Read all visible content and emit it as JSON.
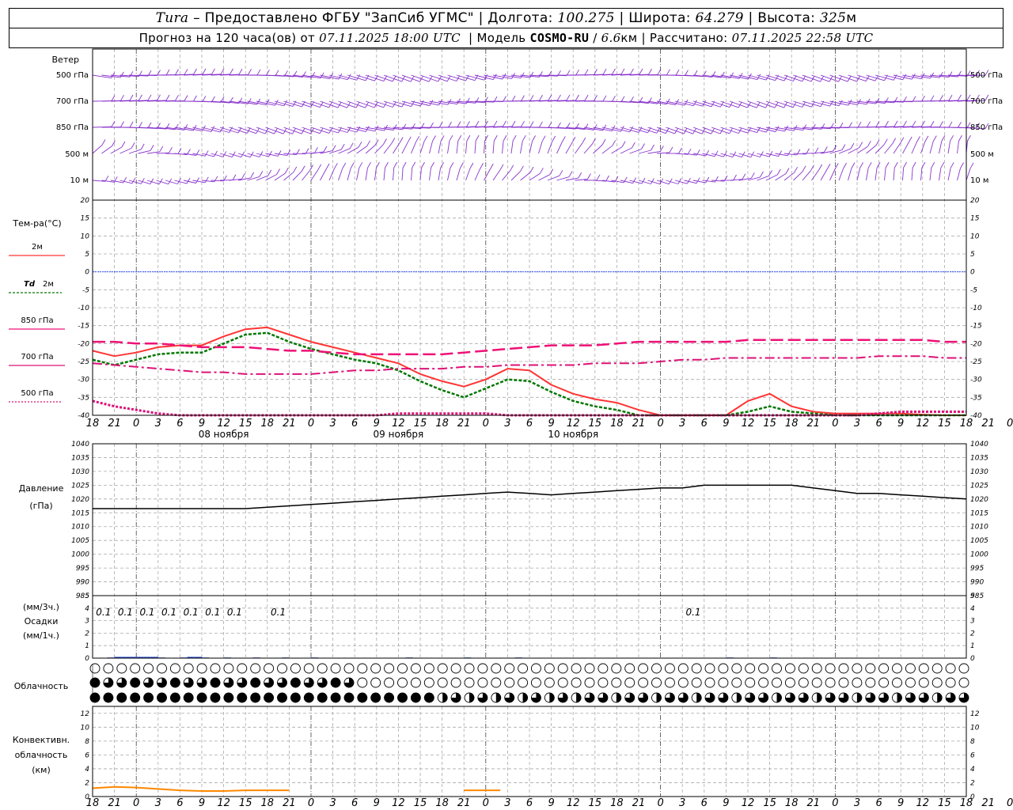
{
  "header": {
    "station": "Tura",
    "provider": "– Предоставлено ФГБУ \"ЗапСиб УГМС\"",
    "lon_label": "Долгота:",
    "lon": "100.275",
    "lat_label": "Широта:",
    "lat": "64.279",
    "alt_label": "Высота:",
    "alt": "325",
    "alt_unit": "м",
    "forecast_prefix": "Прогноз на 120 часа(ов) от",
    "forecast_time": "07.11.2025 18:00 UTC",
    "model_label": "Модель",
    "model": "COSMO-RU",
    "resolution": "6.6",
    "res_unit": "км",
    "calc_label": "Рассчитано:",
    "calc_time": "07.11.2025 22:58 UTC"
  },
  "colors": {
    "t2m": "#ff3333",
    "td2m": "#007700",
    "t850": "#ee1177",
    "t700": "#dd1177",
    "t500": "#dd1177",
    "zero_line": "#3355ff",
    "pressure": "#000000",
    "precip": "#2244cc",
    "convective": "#ff8800",
    "wind": "#8833cc",
    "grid": "#aaaaaa"
  },
  "icons": {
    "wind": "wind-barb-icon",
    "cloud": "cloud-cover-circle-icon"
  },
  "chart_data": [
    {
      "type": "wind-barbs",
      "title": "Ветер",
      "levels": [
        "500 гПа",
        "700 гПа",
        "850 гПа",
        "500 м",
        "10 м"
      ]
    },
    {
      "type": "line",
      "title": "Тем-ра(°C)",
      "ylim": [
        -40,
        20
      ],
      "yticks": [
        20,
        15,
        10,
        5,
        0,
        -5,
        -10,
        -15,
        -20,
        -25,
        -30,
        -35,
        -40
      ],
      "x_hours": [
        0,
        3,
        6,
        9,
        12,
        15,
        18,
        21,
        24,
        27,
        30,
        33,
        36,
        39,
        42,
        45,
        48,
        51,
        54,
        57,
        60,
        63,
        66,
        69,
        72,
        75,
        78,
        81,
        84,
        87,
        90,
        93,
        96,
        99,
        102,
        105,
        108,
        111,
        114,
        117,
        120
      ],
      "x_tick_labels": [
        "18",
        "21",
        "0",
        "3",
        "6",
        "9",
        "12",
        "15",
        "18",
        "21",
        "0",
        "3",
        "6",
        "9",
        "12",
        "15",
        "18",
        "21",
        "0",
        "3",
        "6",
        "9",
        "12",
        "15",
        "18",
        "21",
        "0",
        "3",
        "6",
        "9",
        "12",
        "15",
        "18",
        "21",
        "0",
        "3",
        "6",
        "9",
        "12",
        "15",
        "18",
        "21",
        "0"
      ],
      "day_labels": [
        "08 ноября",
        "09 ноября",
        "10 ноября"
      ],
      "series": [
        {
          "name": "2м",
          "values": [
            -22,
            -23.5,
            -22.5,
            -21,
            -20.5,
            -20.5,
            -18,
            -16,
            -15.5,
            -17.5,
            -19.5,
            -21,
            -22.5,
            -24,
            -25.5,
            -28.5,
            -30.5,
            -32,
            -30,
            -27,
            -27.5,
            -31.5,
            -34,
            -35.5,
            -36.5,
            -38.5,
            -40,
            -40,
            -40,
            -40,
            -36,
            -34,
            -37.5,
            -39,
            -39.5,
            -39.5,
            -39.5,
            -39.5,
            -39.8,
            -40,
            -40
          ]
        },
        {
          "name": "Td 2м",
          "values": [
            -24.5,
            -26,
            -24.5,
            -23,
            -22.5,
            -22.5,
            -20,
            -17.5,
            -17,
            -19.5,
            -21.5,
            -23,
            -24.5,
            -25.5,
            -27.5,
            -30.5,
            -33,
            -35,
            -32.5,
            -30,
            -30.5,
            -33.5,
            -36,
            -37.5,
            -38.5,
            -40,
            -40,
            -40,
            -40,
            -40,
            -39,
            -37.5,
            -39,
            -39.5,
            -40,
            -40,
            -40,
            -40,
            -40,
            -40,
            -40
          ]
        },
        {
          "name": "850 гПа",
          "values": [
            -19.5,
            -19.5,
            -20,
            -20,
            -20.5,
            -21,
            -21,
            -21,
            -21.5,
            -22,
            -22,
            -22.5,
            -23,
            -23,
            -23,
            -23,
            -23,
            -22.5,
            -22,
            -21.5,
            -21,
            -20.5,
            -20.5,
            -20.5,
            -20,
            -19.5,
            -19.5,
            -19.5,
            -19.5,
            -19.5,
            -19,
            -19,
            -19,
            -19,
            -19,
            -19,
            -19,
            -19,
            -19,
            -19.5,
            -19.5
          ]
        },
        {
          "name": "700 гПа",
          "values": [
            -25.5,
            -26,
            -26.5,
            -27,
            -27.5,
            -28,
            -28,
            -28.5,
            -28.5,
            -28.5,
            -28.5,
            -28,
            -27.5,
            -27.5,
            -27,
            -27,
            -27,
            -26.5,
            -26.5,
            -26,
            -26,
            -26,
            -26,
            -25.5,
            -25.5,
            -25.5,
            -25,
            -24.5,
            -24.5,
            -24,
            -24,
            -24,
            -24,
            -24,
            -24,
            -24,
            -23.5,
            -23.5,
            -23.5,
            -24,
            -24
          ]
        },
        {
          "name": "500 гПа",
          "values": [
            -36,
            -37.5,
            -38.5,
            -39.5,
            -40,
            -40,
            -40,
            -40,
            -40,
            -40,
            -40,
            -40,
            -40,
            -40,
            -39.5,
            -39.5,
            -39.5,
            -39.5,
            -39.5,
            -40,
            -40,
            -40,
            -40,
            -40,
            -40,
            -40,
            -40,
            -40,
            -40,
            -40,
            -40,
            -40,
            -40,
            -40,
            -40,
            -40,
            -39.5,
            -39,
            -39,
            -39,
            -39
          ]
        }
      ]
    },
    {
      "type": "line",
      "title": "Давление",
      "ylabel": "(гПа)",
      "ylim": [
        985,
        1040
      ],
      "yticks": [
        1040,
        1035,
        1030,
        1025,
        1020,
        1015,
        1010,
        1005,
        1000,
        995,
        990,
        985
      ],
      "series": [
        {
          "name": "Давление",
          "values": [
            1016.5,
            1016.5,
            1016.5,
            1016.5,
            1016.5,
            1016.5,
            1016.5,
            1016.5,
            1017,
            1017.5,
            1018,
            1018.5,
            1019,
            1019.5,
            1020,
            1020.5,
            1021,
            1021.5,
            1022,
            1022.5,
            1022,
            1021.5,
            1022,
            1022.5,
            1023,
            1023.5,
            1024,
            1024,
            1025,
            1025,
            1025,
            1025,
            1025,
            1024,
            1023,
            1022,
            1022,
            1021.5,
            1021,
            1020.5,
            1020
          ]
        }
      ]
    },
    {
      "type": "bar",
      "title": "Осадки",
      "ylabel_top": "(мм/3ч.)",
      "ylabel_bottom": "(мм/1ч.)",
      "ylim": [
        0,
        5
      ],
      "yticks": [
        5,
        4,
        3,
        2,
        1,
        0
      ],
      "annotations_3h": [
        "0.1",
        "0.1",
        "0.1",
        "0.1",
        "0.1",
        "0.1",
        "0.1",
        "0.1",
        "0.1"
      ],
      "annotation_hours": [
        1.5,
        4.5,
        7.5,
        10.5,
        13.5,
        16.5,
        19.5,
        25.5,
        82.5
      ],
      "bars_hourly": [
        {
          "h": 2,
          "v": 0.05
        },
        {
          "h": 3,
          "v": 0.1
        },
        {
          "h": 4,
          "v": 0.1
        },
        {
          "h": 5,
          "v": 0.1
        },
        {
          "h": 6,
          "v": 0.1
        },
        {
          "h": 7,
          "v": 0.1
        },
        {
          "h": 8,
          "v": 0.1
        },
        {
          "h": 9,
          "v": 0.05
        },
        {
          "h": 12,
          "v": 0.05
        },
        {
          "h": 13,
          "v": 0.1
        },
        {
          "h": 14,
          "v": 0.1
        },
        {
          "h": 15,
          "v": 0.05
        },
        {
          "h": 18,
          "v": 0.05
        },
        {
          "h": 22,
          "v": 0.05
        },
        {
          "h": 26,
          "v": 0.05
        },
        {
          "h": 30,
          "v": 0.05
        },
        {
          "h": 43,
          "v": 0.05
        },
        {
          "h": 51,
          "v": 0.05
        },
        {
          "h": 58,
          "v": 0.05
        },
        {
          "h": 87,
          "v": 0.05
        },
        {
          "h": 93,
          "v": 0.05
        }
      ]
    },
    {
      "type": "table",
      "title": "Облачность",
      "rows": [
        "high",
        "middle",
        "low"
      ],
      "fraction_scale": "0-4 quarters"
    },
    {
      "type": "area",
      "title": "Конвективн. облачность",
      "ylabel": "(км)",
      "ylim": [
        0,
        13
      ],
      "yticks": [
        12,
        10,
        8,
        6,
        4,
        2,
        0
      ],
      "series": [
        {
          "name": "Конвективн. облачность",
          "values": [
            1.2,
            1.4,
            1.3,
            1.1,
            0.9,
            0.8,
            0.8,
            0.9,
            0.9,
            0.9,
            null,
            null,
            null,
            null,
            null,
            null,
            null,
            null,
            null,
            null,
            null,
            null,
            null,
            null,
            null,
            null,
            null,
            null,
            null,
            null,
            null,
            null,
            null,
            null,
            null,
            null,
            null,
            null,
            null,
            null,
            null
          ]
        }
      ],
      "extra_segment": {
        "from_h": 51,
        "to_h": 56,
        "value": 0.9
      }
    }
  ],
  "labels": {
    "wind_title": "Ветер",
    "wind_levels": [
      "500 гПа",
      "700 гПа",
      "850 гПа",
      "500 м",
      "10 м"
    ],
    "temp_title": "Тем-ра(°C)",
    "legend_t2m": "2м",
    "legend_td_prefix": "Td",
    "legend_td": "2м",
    "legend_850": "850 гПа",
    "legend_700": "700 гПа",
    "legend_500": "500 гПа",
    "pressure_title": "Давление",
    "pressure_unit": "(гПа)",
    "precip_3h": "(мм/3ч.)",
    "precip_title": "Осадки",
    "precip_1h": "(мм/1ч.)",
    "cloud_title": "Облачность",
    "conv_title1": "Конвективн.",
    "conv_title2": "облачность",
    "conv_unit": "(км)"
  }
}
